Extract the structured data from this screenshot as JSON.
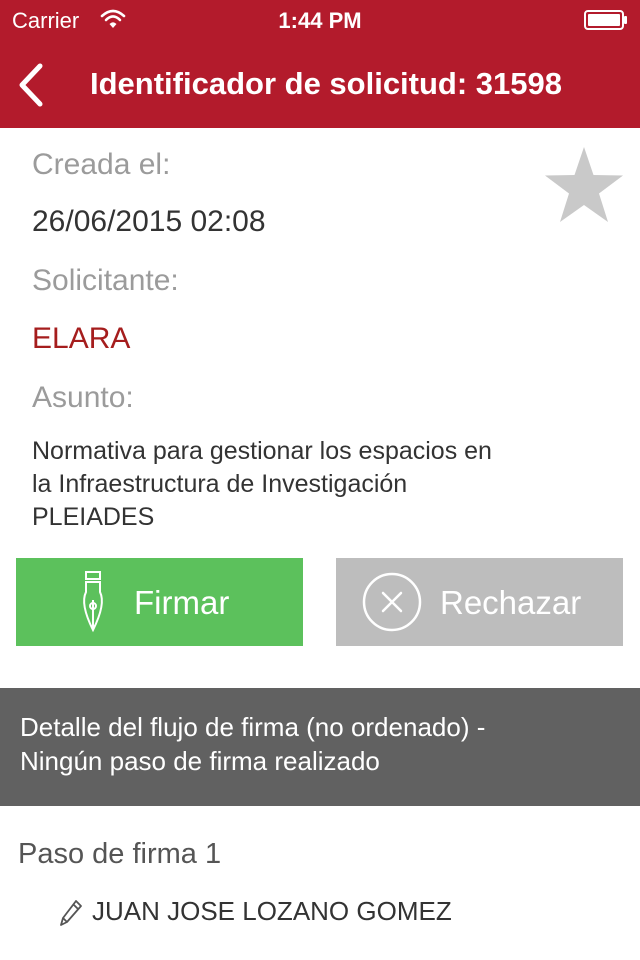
{
  "status_bar": {
    "carrier": "Carrier",
    "time": "1:44 PM",
    "wifi_icon": "wifi-icon",
    "battery_icon": "battery-icon"
  },
  "nav": {
    "title": "Identificador de solicitud: 31598",
    "back_icon": "chevron-left-icon",
    "background_color": "#b31b2c"
  },
  "details": {
    "created_label": "Creada el:",
    "created_value": "26/06/2015 02:08",
    "applicant_label": "Solicitante:",
    "applicant_value": "ELARA",
    "subject_label": "Asunto:",
    "subject_lines": [
      "Normativa para gestionar los espacios en",
      "la Infraestructura de Investigación",
      "PLEIADES"
    ],
    "favorite_icon": "star-icon"
  },
  "actions": {
    "sign_label": "Firmar",
    "sign_icon": "fountain-pen-icon",
    "sign_color": "#5cc15c",
    "reject_label": "Rechazar",
    "reject_icon": "circle-x-icon",
    "reject_color": "#bdbdbd"
  },
  "flow": {
    "header_lines": [
      "Detalle del flujo de firma (no ordenado) -",
      "Ningún paso de firma realizado"
    ],
    "steps": [
      {
        "title": "Paso de firma 1",
        "signers": [
          "JUAN JOSE LOZANO GOMEZ"
        ],
        "signer_icon": "pen-icon"
      }
    ]
  }
}
